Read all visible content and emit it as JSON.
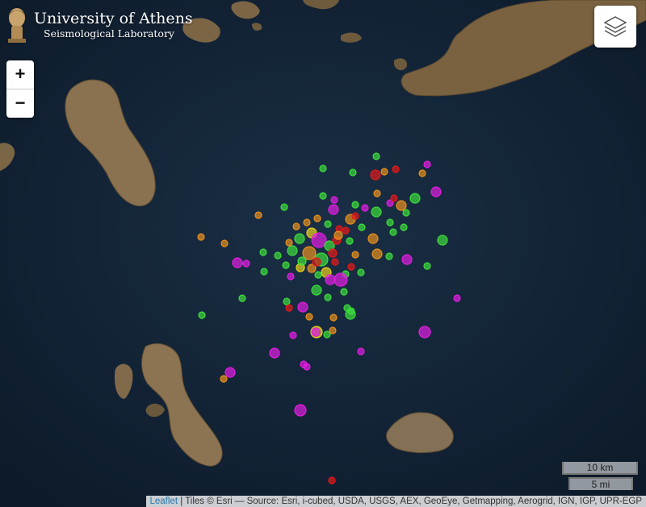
{
  "header": {
    "title": "University of Athens",
    "subtitle": "Seismological Laboratory"
  },
  "controls": {
    "zoom_in": "+",
    "zoom_out": "−",
    "layers_icon": "layers-icon"
  },
  "scale": {
    "km": "10 km",
    "mi": "5 mi"
  },
  "attribution": {
    "leaflet": "Leaflet",
    "separator": " | ",
    "tiles": "Tiles © Esri — Source: Esri, i-cubed, USDA, USGS, AEX, GeoEye, Getmapping, Aerogrid, IGN, IGP, UPR-EGP"
  },
  "colors": {
    "sea": "#13263a",
    "land": "#6d5a3c",
    "event_green": "#3ddc3d",
    "event_orange": "#e8901c",
    "event_red": "#e01a1a",
    "event_magenta": "#e21ee2",
    "event_yellow": "#e8d21c"
  }
}
